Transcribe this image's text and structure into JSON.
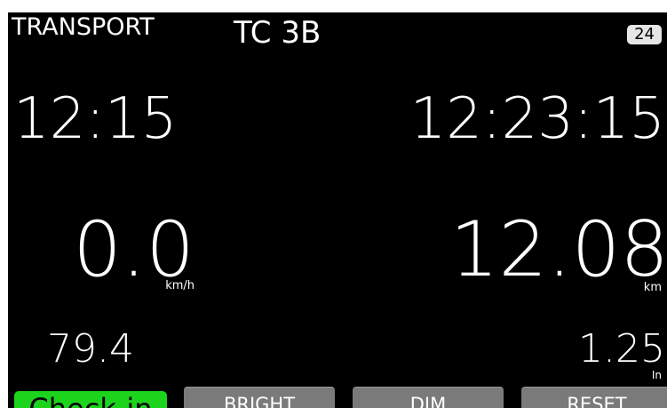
{
  "header": {
    "mode": "TRANSPORT",
    "stage": "TC 3B",
    "badge": "24"
  },
  "times": {
    "left": "12:15",
    "right": "12:23:15"
  },
  "speed": {
    "value": "0.0",
    "unit": "km/h"
  },
  "distance": {
    "value": "12.08",
    "unit": "km"
  },
  "lower": {
    "left_value": "79.4",
    "right_value": "1.25",
    "right_unit": "In"
  },
  "buttons": {
    "checkin": "Check-in",
    "bright": "BRIGHT",
    "dim": "DIM",
    "reset": "RESET"
  },
  "colors": {
    "background": "#000000",
    "checkin": "#1dd41d",
    "softkey": "#7a7a7a"
  }
}
